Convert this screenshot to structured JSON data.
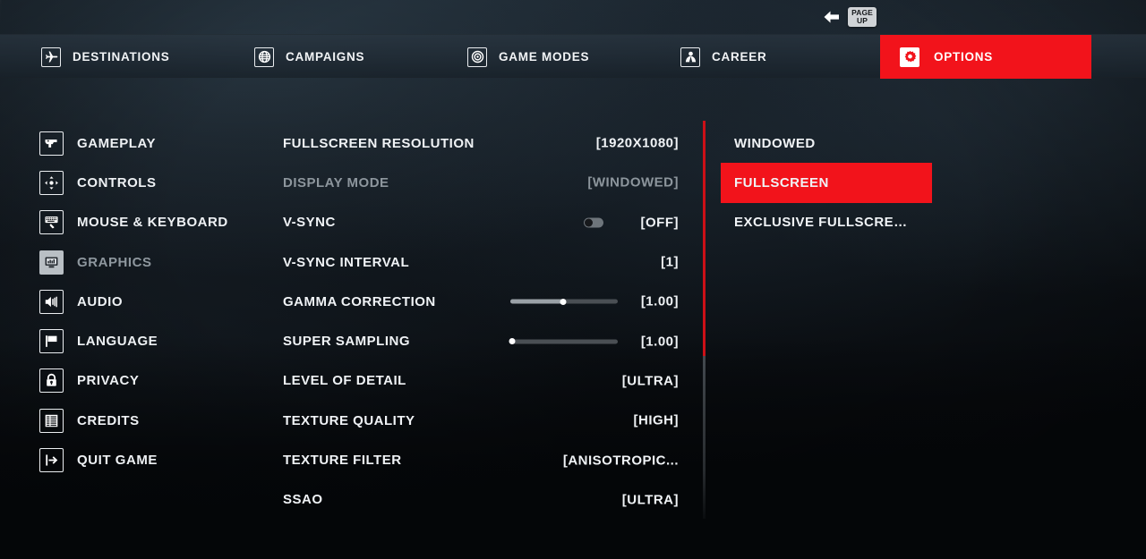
{
  "hint": {
    "arrow_icon": "arrow-left-icon",
    "key_line1": "PAGE",
    "key_line2": "UP"
  },
  "topnav": {
    "items": [
      {
        "label": "DESTINATIONS",
        "icon": "airplane-icon",
        "active": false
      },
      {
        "label": "CAMPAIGNS",
        "icon": "globe-icon",
        "active": false
      },
      {
        "label": "GAME MODES",
        "icon": "target-icon",
        "active": false
      },
      {
        "label": "CAREER",
        "icon": "person-icon",
        "active": false
      },
      {
        "label": "OPTIONS",
        "icon": "gear-icon",
        "active": true
      }
    ]
  },
  "sidebar": {
    "items": [
      {
        "label": "GAMEPLAY",
        "icon": "pistol-icon",
        "selected": false
      },
      {
        "label": "CONTROLS",
        "icon": "dpad-icon",
        "selected": false
      },
      {
        "label": "MOUSE & KEYBOARD",
        "icon": "keyboard-icon",
        "selected": false
      },
      {
        "label": "GRAPHICS",
        "icon": "monitor-icon",
        "selected": true
      },
      {
        "label": "AUDIO",
        "icon": "speaker-icon",
        "selected": false
      },
      {
        "label": "LANGUAGE",
        "icon": "flag-icon",
        "selected": false
      },
      {
        "label": "PRIVACY",
        "icon": "lock-icon",
        "selected": false
      },
      {
        "label": "CREDITS",
        "icon": "list-icon",
        "selected": false
      },
      {
        "label": "QUIT GAME",
        "icon": "exit-icon",
        "selected": false
      }
    ]
  },
  "settings": {
    "rows": [
      {
        "label": "FULLSCREEN RESOLUTION",
        "value": "[1920X1080]",
        "control": "none",
        "focused": false
      },
      {
        "label": "DISPLAY MODE",
        "value": "[WINDOWED]",
        "control": "none",
        "focused": true
      },
      {
        "label": "V-SYNC",
        "value": "[OFF]",
        "control": "toggle",
        "toggle_on": false,
        "focused": false
      },
      {
        "label": "V-SYNC INTERVAL",
        "value": "[1]",
        "control": "none",
        "focused": false
      },
      {
        "label": "GAMMA CORRECTION",
        "value": "[1.00]",
        "control": "slider",
        "slider_percent": 49,
        "focused": false
      },
      {
        "label": "SUPER SAMPLING",
        "value": "[1.00]",
        "control": "slider",
        "slider_percent": 2,
        "focused": false
      },
      {
        "label": "LEVEL OF DETAIL",
        "value": "[ULTRA]",
        "control": "none",
        "focused": false
      },
      {
        "label": "TEXTURE QUALITY",
        "value": "[HIGH]",
        "control": "none",
        "focused": false
      },
      {
        "label": "TEXTURE FILTER",
        "value": "[ANISOTROPIC...",
        "control": "none",
        "focused": false
      },
      {
        "label": "SSAO",
        "value": "[ULTRA]",
        "control": "none",
        "focused": false
      }
    ]
  },
  "submenu": {
    "title": "DISPLAY MODE",
    "options": [
      {
        "label": "WINDOWED",
        "selected": false
      },
      {
        "label": "FULLSCREEN",
        "selected": true
      },
      {
        "label": "EXCLUSIVE FULLSCRE…",
        "selected": false
      }
    ]
  },
  "colors": {
    "accent_red": "#f2131b",
    "divider_red": "#cc1017",
    "text_primary": "#f0f3f6",
    "text_dim": "#8d969d",
    "background": "#0a0d10"
  }
}
